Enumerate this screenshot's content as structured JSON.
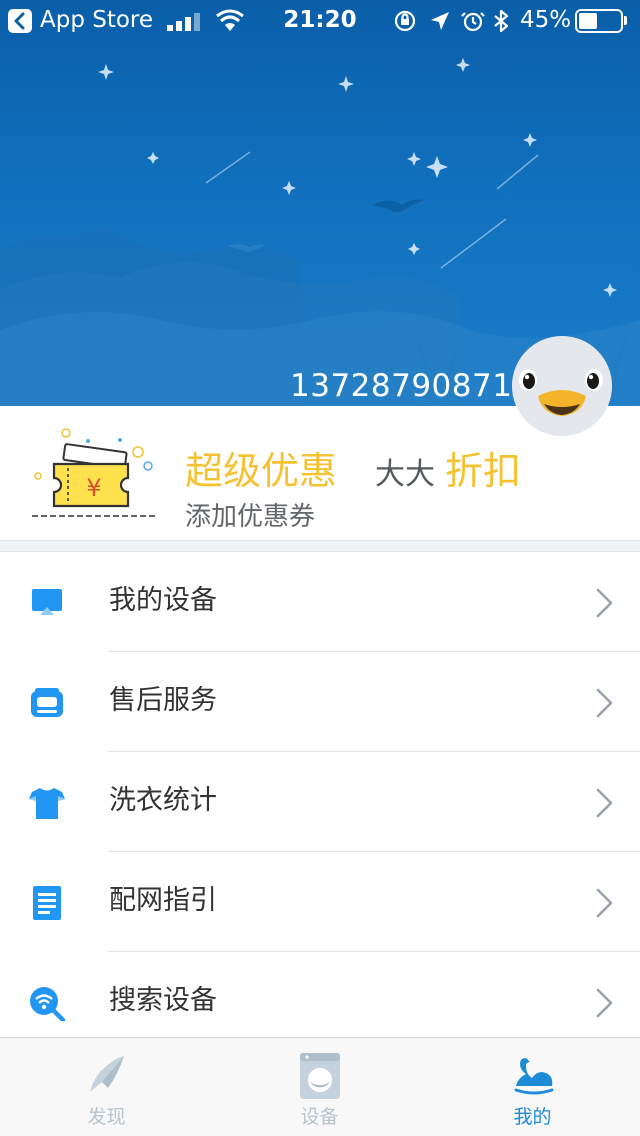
{
  "status_bar": {
    "back_app": "App Store",
    "time": "21:20",
    "battery_percent": "45%",
    "battery_level": 0.45,
    "icons": [
      "back-arrow-icon",
      "cellular-signal-icon",
      "wifi-icon",
      "rotation-lock-icon",
      "location-arrow-icon",
      "alarm-icon",
      "bluetooth-icon",
      "battery-icon"
    ]
  },
  "profile": {
    "phone": "13728790871",
    "avatar_icon": "duck-avatar-icon"
  },
  "coupon_banner": {
    "title": "超级优惠",
    "mid_text": "大大",
    "discount_text": "折扣",
    "subtitle": "添加优惠券",
    "icon": "coupon-ticket-icon",
    "accent_color": "#f5c232"
  },
  "menu": {
    "items": [
      {
        "label": "我的设备",
        "icon": "monitor-icon"
      },
      {
        "label": "售后服务",
        "icon": "service-phone-icon"
      },
      {
        "label": "洗衣统计",
        "icon": "tshirt-icon"
      },
      {
        "label": "配网指引",
        "icon": "guide-document-icon"
      },
      {
        "label": "搜索设备",
        "icon": "wifi-search-icon"
      }
    ],
    "chevron_icon": "chevron-right-icon"
  },
  "tab_bar": {
    "tabs": [
      {
        "label": "发现",
        "icon": "compass-icon",
        "active": false
      },
      {
        "label": "设备",
        "icon": "washing-machine-icon",
        "active": false
      },
      {
        "label": "我的",
        "icon": "swan-icon",
        "active": true
      }
    ],
    "active_color": "#1e8bd8",
    "inactive_color": "#b9c4cd"
  },
  "colors": {
    "header_blue": "#1170bd",
    "icon_blue": "#2196f3"
  }
}
